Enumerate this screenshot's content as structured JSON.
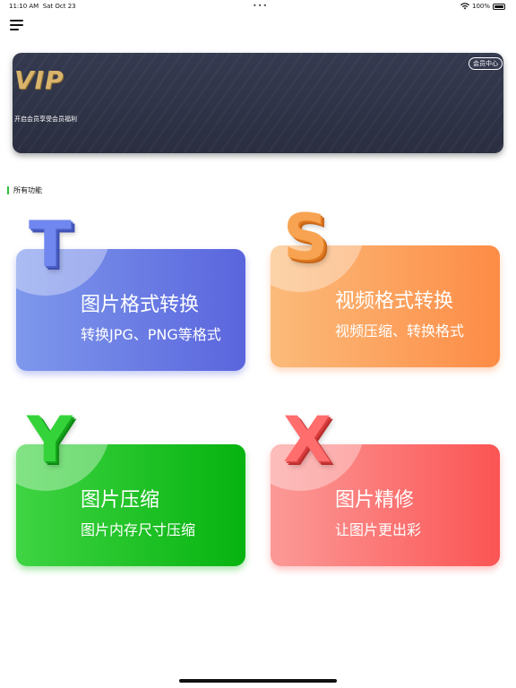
{
  "status_bar": {
    "time": "11:10 AM",
    "date": "Sat Oct 23",
    "battery": "100%",
    "multitask_dots": "•••"
  },
  "header": {
    "menu_icon": "hamburger-menu-icon"
  },
  "vip_banner": {
    "logo_text": "VIP",
    "subtitle": "开启会员享受会员福利",
    "member_center_label": "会员中心"
  },
  "section": {
    "title": "所有功能",
    "accent_color": "#2fbf3c"
  },
  "features": [
    {
      "letter": "T",
      "title": "图片格式转换",
      "subtitle": "转换JPG、PNG等格式",
      "color": "#5a65dd"
    },
    {
      "letter": "S",
      "title": "视频格式转换",
      "subtitle": "视频压缩、转换格式",
      "color": "#fd8c46"
    },
    {
      "letter": "Y",
      "title": "图片压缩",
      "subtitle": "图片内存尺寸压缩",
      "color": "#06b30f"
    },
    {
      "letter": "X",
      "title": "图片精修",
      "subtitle": "让图片更出彩",
      "color": "#fb5454"
    }
  ]
}
